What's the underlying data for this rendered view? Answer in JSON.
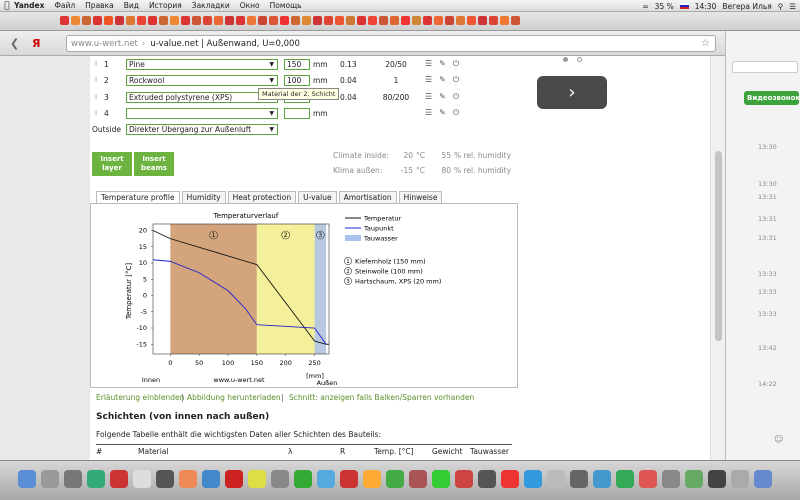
{
  "menubar": {
    "app": "Yandex",
    "items": [
      "Файл",
      "Правка",
      "Вид",
      "История",
      "Закладки",
      "Окно",
      "Помощь"
    ],
    "battery": "35 %",
    "time": "14:30",
    "user": "Вегера Илья"
  },
  "address": {
    "host": "www.u-wert.net",
    "title": "u-value.net | Außenwand, U=0,000"
  },
  "layers": [
    {
      "num": "1",
      "material": "Pine",
      "thickness": "150",
      "unit": "mm",
      "lambda": "0.13",
      "mu": "20/50"
    },
    {
      "num": "2",
      "material": "Rockwool",
      "thickness": "100",
      "unit": "mm",
      "lambda": "0.04",
      "mu": "1"
    },
    {
      "num": "3",
      "material": "Extruded polystyrene (XPS)",
      "thickness": "20",
      "unit": "mm",
      "lambda": "0.04",
      "mu": "80/200"
    },
    {
      "num": "4",
      "material": "",
      "thickness": "",
      "unit": "mm",
      "lambda": "",
      "mu": ""
    }
  ],
  "outside": {
    "label": "Outside",
    "value": "Direkter Übergang zur Außenluft"
  },
  "tooltip": "Material der 2. Schicht",
  "buttons": {
    "insert_layer": "Insert layer",
    "insert_beams": "Insert beams"
  },
  "climate": {
    "inside_label": "Climate inside:",
    "inside_temp": "20",
    "inside_unit": "°C",
    "inside_hum": "55",
    "hum_unit": "% rel. humidity",
    "outside_label": "Klima außen:",
    "outside_temp": "-15",
    "outside_unit": "°C",
    "outside_hum": "80"
  },
  "tabs": [
    "Temperature profile",
    "Humidity",
    "Heat protection",
    "U-value",
    "Amortisation",
    "Hinweise"
  ],
  "links": {
    "explain": "Erläuterung einblenden",
    "download": "Abbildung herunterladen",
    "cut": "Schnitt: anzeigen falls Balken/Sparren vorhanden"
  },
  "section": {
    "heading": "Schichten (von innen nach außen)",
    "intro": "Folgende Tabelle enthält die wichtigsten Daten aller Schichten des Bauteils:",
    "columns": [
      "#",
      "Material",
      "λ",
      "R",
      "Temp. [°C]",
      "Gewicht",
      "Tauwasser"
    ]
  },
  "chart_data": {
    "type": "line",
    "title": "Temperaturverlauf",
    "ylabel": "Temperatur [°C]",
    "xlabel": "[mm]",
    "xlim": [
      -30,
      275
    ],
    "ylim": [
      -18,
      22
    ],
    "xticks": [
      0,
      50,
      100,
      150,
      200,
      250
    ],
    "yticks": [
      20,
      15,
      10,
      5,
      0,
      -5,
      -10,
      -15
    ],
    "x_left_label": "Innen",
    "x_right_label": "Außen",
    "source": "www.u-wert.net",
    "layers": [
      {
        "id": "1",
        "from": 0,
        "to": 150,
        "label": "Kiefernholz (150 mm)",
        "color": "#d4a57c"
      },
      {
        "id": "2",
        "from": 150,
        "to": 250,
        "label": "Steinwolle (100 mm)",
        "color": "#f4ef9a"
      },
      {
        "id": "3",
        "from": 250,
        "to": 270,
        "label": "Hartschaum, XPS (20 mm)",
        "color": "#b8c8de"
      }
    ],
    "series": [
      {
        "name": "Temperatur",
        "color": "#111111",
        "x": [
          -30,
          0,
          150,
          250,
          270,
          275
        ],
        "y": [
          20,
          17.5,
          9.5,
          -14,
          -15,
          -15
        ]
      },
      {
        "name": "Taupunkt",
        "color": "#2222cc",
        "x": [
          -30,
          0,
          50,
          100,
          130,
          150,
          250,
          270
        ],
        "y": [
          11,
          10.5,
          7,
          1.5,
          -4,
          -9,
          -10,
          -15
        ]
      }
    ],
    "legend": [
      "Temperatur",
      "Taupunkt",
      "Tauwasser"
    ],
    "legend_colors": [
      "#111111",
      "#2222cc",
      "#aac4ee"
    ]
  },
  "sidebar": {
    "video_call": "Видеозвонок",
    "times": [
      "13:30",
      "13:30",
      "13:31",
      "13:31",
      "13:31",
      "13:33",
      "13:33",
      "13:33",
      "13:42",
      "14:22"
    ]
  }
}
